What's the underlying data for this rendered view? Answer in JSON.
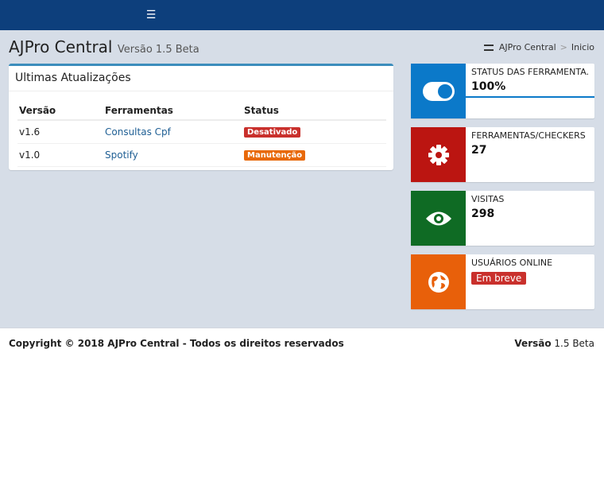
{
  "header": {
    "menu_icon": "hamburger-icon"
  },
  "page": {
    "title": "AJPro Central",
    "subtitle": "Versão 1.5 Beta"
  },
  "breadcrumb": {
    "home": "AJPro Central",
    "separator": ">",
    "current": "Inicio"
  },
  "updates": {
    "title": "Ultimas Atualizações",
    "columns": [
      "Versão",
      "Ferramentas",
      "Status"
    ],
    "rows": [
      {
        "version": "v1.6",
        "tool": "Consultas Cpf",
        "status": "Desativado",
        "status_color": "#c9302c"
      },
      {
        "version": "v1.0",
        "tool": "Spotify",
        "status": "Manutenção",
        "status_color": "#e8690a"
      }
    ]
  },
  "info_boxes": [
    {
      "label": "STATUS DAS FERRAMENTA.",
      "value": "100%",
      "icon": "toggle-icon",
      "color": "#0b79c9"
    },
    {
      "label": "FERRAMENTAS/CHECKERS",
      "value": "27",
      "icon": "gear-icon",
      "color": "#bb1511"
    },
    {
      "label": "VISITAS",
      "value": "298",
      "icon": "eye-icon",
      "color": "#0f6b24"
    },
    {
      "label": "USUÁRIOS ONLINE",
      "value": "Em breve",
      "icon": "globe-icon",
      "color": "#e8600a",
      "badge_color": "#c9302c"
    }
  ],
  "footer": {
    "copyright": "Copyright © 2018 AJPro Central - Todos os direitos reservados",
    "version_label": "Versão",
    "version": "1.5 Beta"
  }
}
